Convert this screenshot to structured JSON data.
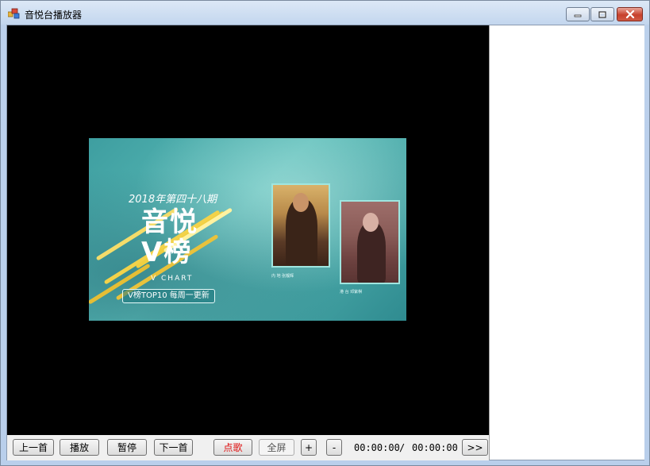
{
  "window": {
    "title": "音悦台播放器",
    "app_icon": "app-window-icon",
    "controls": {
      "minimize": "minimize-icon",
      "maximize": "maximize-icon",
      "close": "close-icon"
    }
  },
  "video": {
    "thumbnail": {
      "issue": "2018年第四十八期",
      "logo_line1": "音悦",
      "logo_line2": "V榜",
      "subtitle": "V CHART",
      "banner": "V榜TOP10  每周一更新",
      "caption1": "内 地    张靓辉",
      "caption2": "港 台    邓紫棋"
    }
  },
  "controls": {
    "prev": "上一首",
    "play": "播放",
    "pause": "暂停",
    "next": "下一首",
    "request": "点歌",
    "fullscreen": "全屏",
    "vol_up": "+",
    "vol_down": "-",
    "current_time": "00:00:00",
    "separator": "/",
    "total_time": "00:00:00",
    "toggle_panel": ">>"
  },
  "colors": {
    "titlebar": "#c3d6ee",
    "video_bg": "#000000",
    "request_text": "#e01010"
  }
}
